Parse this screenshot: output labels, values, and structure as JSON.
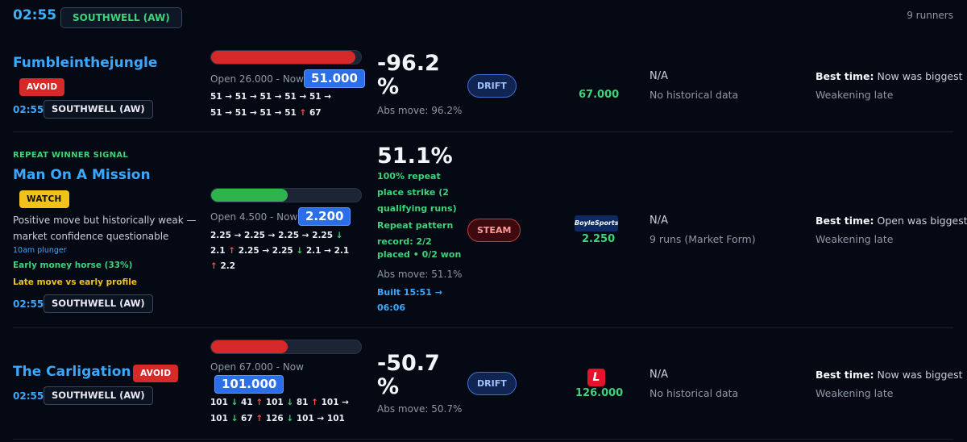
{
  "header": {
    "time": "02:55",
    "meeting": "SOUTHWELL (AW)",
    "runners": "9 runners"
  },
  "rows": [
    {
      "name": "Fumbleinthejungle",
      "tag": "AVOID",
      "time": "02:55",
      "meeting": "SOUTHWELL (AW)",
      "bar_fraction": 0.96,
      "open_now": "Open 26.000 - Now",
      "now_price": "51.000",
      "seq_line1": [
        "51",
        "→",
        "51",
        "→",
        "51",
        "→",
        "51",
        "→",
        "51",
        "→"
      ],
      "seq_line2": [
        "51",
        "→",
        "51",
        "→",
        "51",
        "→",
        "51",
        "↑",
        "67"
      ],
      "pct": [
        "-96.2",
        "%"
      ],
      "abs_move": "Abs move: 96.2%",
      "movement": "DRIFT",
      "best_odds": "67.000",
      "hist_title": "N/A",
      "hist_detail": "No historical data",
      "best_time_label": "Best time:",
      "best_time_value": "Now was biggest",
      "late": "Weakening late"
    },
    {
      "signal": "REPEAT WINNER SIGNAL",
      "name": "Man On A Mission",
      "tag": "WATCH",
      "desc_line1": "Positive move but historically weak —",
      "desc_line2": "market confidence questionable",
      "plunger": "10am plunger",
      "early": "Early money horse (33%)",
      "late_profile": "Late move vs early profile",
      "time": "02:55",
      "meeting": "SOUTHWELL (AW)",
      "bar_fraction": 0.51,
      "open_now": "Open 4.500 - Now",
      "now_price": "2.200",
      "seq_line1": [
        "2.25",
        "→",
        "2.25",
        "→",
        "2.25",
        "→",
        "2.25",
        "↓"
      ],
      "seq_line2": [
        "2.1",
        "↑",
        "2.25",
        "→",
        "2.25",
        "↓",
        "2.1",
        "→",
        "2.1"
      ],
      "seq_line3": [
        "↑",
        "2.2"
      ],
      "pct": [
        "51.1%"
      ],
      "repeat_lines": [
        "100% repeat",
        "place strike (2",
        "qualifying runs)"
      ],
      "pattern_lines": [
        "Repeat pattern",
        "record: 2/2",
        "placed • 0/2 won"
      ],
      "abs_move": "Abs move: 51.1%",
      "built_lines": [
        "Built 15:51 →",
        "06:06"
      ],
      "movement": "STEAM",
      "bookmaker": "BoyleSports",
      "best_odds": "2.250",
      "hist_title": "N/A",
      "hist_detail": "9 runs (Market Form)",
      "best_time_label": "Best time:",
      "best_time_value": "Open was biggest",
      "late": "Weakening late"
    },
    {
      "name": "The Carligation",
      "tag": "AVOID",
      "time": "02:55",
      "meeting": "SOUTHWELL (AW)",
      "bar_fraction": 0.51,
      "open_now": "Open 67.000 - Now",
      "now_price": "101.000",
      "seq_line1": [
        "101",
        "↓",
        "41",
        "↑",
        "101",
        "↓",
        "81",
        "↑",
        "101",
        "→"
      ],
      "seq_line2": [
        "101",
        "↓",
        "67",
        "↑",
        "126",
        "↓",
        "101",
        "→",
        "101"
      ],
      "pct": [
        "-50.7",
        "%"
      ],
      "abs_move": "Abs move: 50.7%",
      "movement": "DRIFT",
      "bookmaker": "L",
      "best_odds": "126.000",
      "hist_title": "N/A",
      "hist_detail": "No historical data",
      "best_time_label": "Best time:",
      "best_time_value": "Now was biggest",
      "late": "Weakening late"
    }
  ],
  "colors": {
    "accent": "#3aa8ff",
    "green": "#3ed27a",
    "red": "#d62a2a",
    "yellow": "#f1c21b",
    "bg": "#050914"
  }
}
